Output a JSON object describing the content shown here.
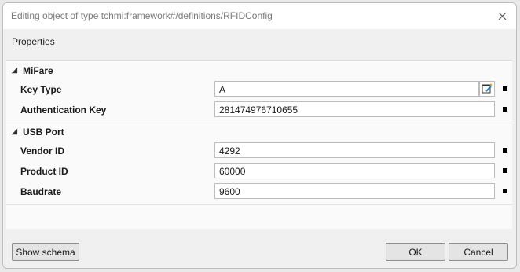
{
  "window": {
    "title": "Editing object of type tchmi:framework#/definitions/RFIDConfig",
    "close_icon": "close-icon"
  },
  "section_title": "Properties",
  "groups": [
    {
      "label": "MiFare",
      "properties": [
        {
          "label": "Key Type",
          "value": "A",
          "has_editor_button": true
        },
        {
          "label": "Authentication Key",
          "value": "281474976710655",
          "has_editor_button": false
        }
      ]
    },
    {
      "label": "USB Port",
      "properties": [
        {
          "label": "Vendor ID",
          "value": "4292",
          "has_editor_button": false
        },
        {
          "label": "Product ID",
          "value": "60000",
          "has_editor_button": false
        },
        {
          "label": "Baudrate",
          "value": "9600",
          "has_editor_button": false
        }
      ]
    }
  ],
  "footer": {
    "show_schema_label": "Show schema",
    "ok_label": "OK",
    "cancel_label": "Cancel"
  }
}
